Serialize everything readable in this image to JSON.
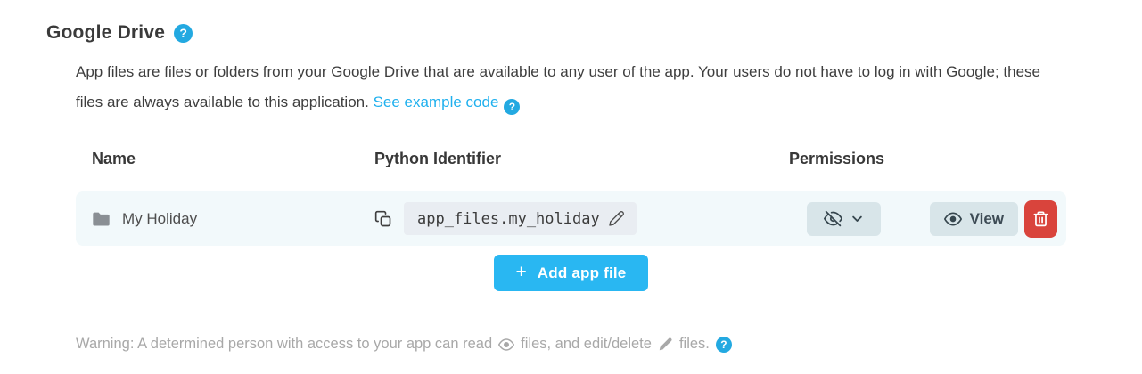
{
  "header": {
    "title": "Google Drive"
  },
  "glyphs": {
    "question": "?",
    "plus": "+"
  },
  "description": {
    "text": "App files are files or folders from your Google Drive that are available to any user of the app. Your users do not have to log in with Google; these files are always available to this application.",
    "link_label": "See example code"
  },
  "table": {
    "columns": [
      "Name",
      "Python Identifier",
      "Permissions"
    ],
    "rows": [
      {
        "name": "My Holiday",
        "icon": "folder-icon",
        "python_identifier": "app_files.my_holiday",
        "permission_state": "hidden",
        "view_label": "View"
      }
    ]
  },
  "actions": {
    "add_button_label": "Add app file"
  },
  "warning": {
    "part1": "Warning: A determined person with access to your app can read",
    "part2": "files, and edit/delete",
    "part3": "files."
  },
  "colors": {
    "accent_blue": "#29b7f2",
    "help_blue": "#23a9e1",
    "link_blue": "#1fb0ee",
    "danger_red": "#d9443c",
    "button_gray": "#d8e5e9",
    "row_bg": "#f2f9fb",
    "pill_bg": "#e9edf2"
  }
}
